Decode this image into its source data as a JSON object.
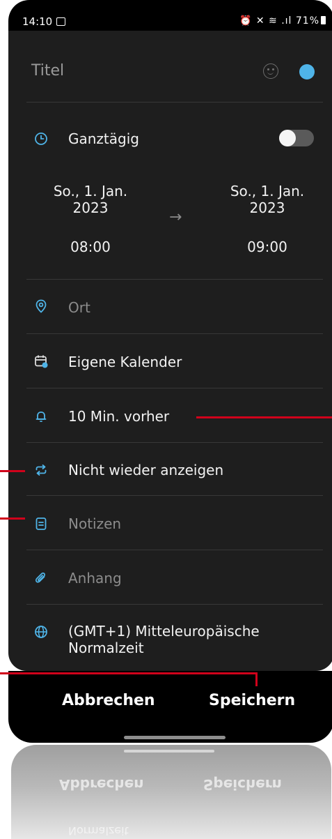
{
  "status_bar": {
    "time": "14:10",
    "right": "⏰ ✕ ≋ .ıl 71%"
  },
  "event": {
    "title_placeholder": "Titel",
    "color_accent": "#4fb4e8"
  },
  "all_day": {
    "label": "Ganztägig",
    "enabled": false
  },
  "start": {
    "date_line1": "So., 1. Jan.",
    "date_line2": "2023",
    "time": "08:00"
  },
  "end": {
    "date_line1": "So., 1. Jan.",
    "date_line2": "2023",
    "time": "09:00"
  },
  "arrow": "→",
  "rows": {
    "location": "Ort",
    "calendar": "Eigene Kalender",
    "reminder": "10 Min. vorher",
    "repeat": "Nicht wieder anzeigen",
    "notes": "Notizen",
    "attachment": "Anhang",
    "timezone_line1": "(GMT+1) Mitteleuropäische",
    "timezone_line2": "Normalzeit"
  },
  "actions": {
    "cancel": "Abbrechen",
    "save": "Speichern"
  },
  "reflection": {
    "cancel": "Abbrechen",
    "save": "Speichern",
    "timezone_fragment": "Normalzeit"
  },
  "colors": {
    "annotation_red": "#d0021b",
    "icon_blue": "#4fb4e8"
  }
}
